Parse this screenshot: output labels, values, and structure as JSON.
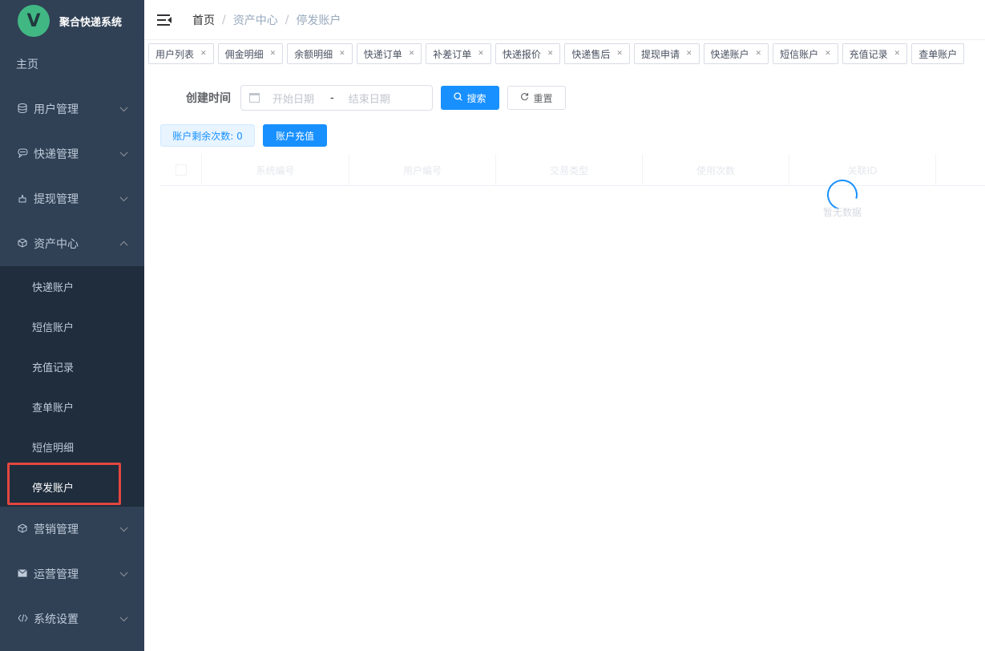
{
  "app": {
    "logo_letter": "V",
    "title": "聚合快递系统"
  },
  "sidebar": {
    "home": "主页",
    "menus": [
      {
        "label": "用户管理",
        "icon": "database-icon"
      },
      {
        "label": "快递管理",
        "icon": "chat-icon"
      },
      {
        "label": "提现管理",
        "icon": "hand-icon"
      },
      {
        "label": "资产中心",
        "icon": "cube-icon",
        "expanded": true
      }
    ],
    "submenu": [
      "快递账户",
      "短信账户",
      "充值记录",
      "查单账户",
      "短信明细",
      "停发账户"
    ],
    "menus_after": [
      {
        "label": "营销管理",
        "icon": "cube-icon"
      },
      {
        "label": "运营管理",
        "icon": "mail-icon"
      },
      {
        "label": "系统设置",
        "icon": "code-icon"
      }
    ]
  },
  "breadcrumb": [
    "首页",
    "资产中心",
    "停发账户"
  ],
  "tags": [
    "用户列表",
    "佣金明细",
    "余额明细",
    "快递订单",
    "补差订单",
    "快递报价",
    "快递售后",
    "提现申请",
    "快递账户",
    "短信账户",
    "充值记录",
    "查单账户"
  ],
  "filter": {
    "label": "创建时间",
    "start_placeholder": "开始日期",
    "range_separator": "-",
    "end_placeholder": "结束日期",
    "search_label": "搜索",
    "reset_label": "重置"
  },
  "account": {
    "remaining_label": "账户剩余次数: 0",
    "recharge_label": "账户充值"
  },
  "table": {
    "columns": [
      "系统编号",
      "用户编号",
      "交易类型",
      "使用次数",
      "关联ID"
    ],
    "empty_text": "暂无数据"
  },
  "colors": {
    "sidebar_bg": "#304156",
    "submenu_bg": "#1f2d3d",
    "primary": "#1890ff",
    "highlight": "#e2463f",
    "logo": "#41b883"
  }
}
